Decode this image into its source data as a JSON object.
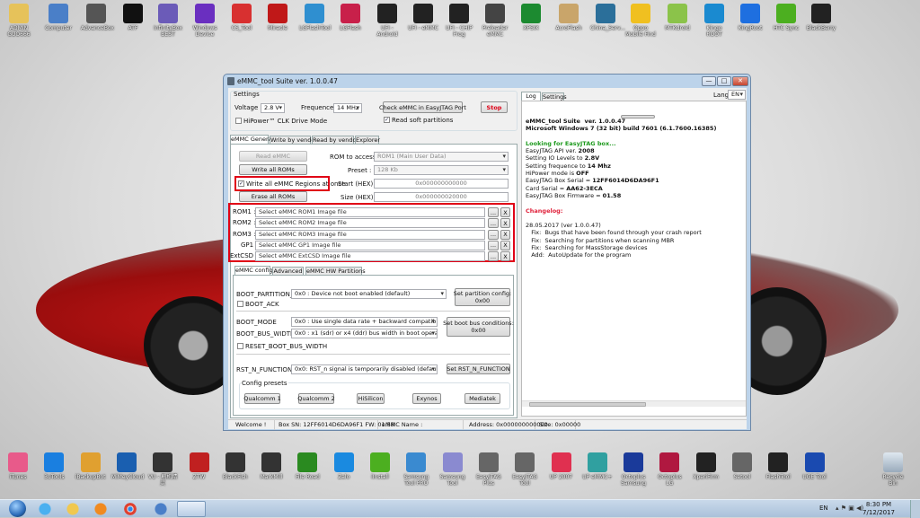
{
  "desktop": {
    "top_icons": [
      {
        "label": "ADMIN GUO666",
        "color": "#e6c25a"
      },
      {
        "label": "Computer",
        "color": "#4a7fc8"
      },
      {
        "label": "AdvanceBox",
        "color": "#555"
      },
      {
        "label": "ATF",
        "color": "#111"
      },
      {
        "label": "InfinityBox BEST",
        "color": "#6b5bb8"
      },
      {
        "label": "Windows Device",
        "color": "#6a2fc0"
      },
      {
        "label": "CS_Tool",
        "color": "#d83030"
      },
      {
        "label": "Miracle",
        "color": "#c01818"
      },
      {
        "label": "LGFlashTool",
        "color": "#2f8fd0"
      },
      {
        "label": "LGFlash",
        "color": "#c8204a"
      },
      {
        "label": "UFI - Android",
        "color": "#222"
      },
      {
        "label": "UFI - eMMC",
        "color": "#222"
      },
      {
        "label": "UFI - CHIP Prog",
        "color": "#222"
      },
      {
        "label": "Preloader eMMC",
        "color": "#444"
      },
      {
        "label": "XPSIX",
        "color": "#1c8a30"
      },
      {
        "label": "AcroFlash",
        "color": "#c9a56a"
      },
      {
        "label": "China_Serv...",
        "color": "#2b6f9a"
      },
      {
        "label": "Oppo Mobile Find",
        "color": "#f0c020"
      },
      {
        "label": "MTKdroid",
        "color": "#8bc34a"
      },
      {
        "label": "Kingo ROOT",
        "color": "#1a8ad0"
      },
      {
        "label": "KingRoot",
        "color": "#1e6fe0"
      },
      {
        "label": "HTC Sync",
        "color": "#4caf20"
      },
      {
        "label": "BlackBerry",
        "color": "#222"
      }
    ],
    "bottom_icons": [
      {
        "label": "iTunes",
        "color": "#e85a8a"
      },
      {
        "label": "3uTools",
        "color": "#1a7fe0"
      },
      {
        "label": "iBackupBot",
        "color": "#e0a030"
      },
      {
        "label": "MiMeyCloud",
        "color": "#1a5fb0"
      },
      {
        "label": "VU - 刷机精灵",
        "color": "#333"
      },
      {
        "label": "ZTW",
        "color": "#c02020"
      },
      {
        "label": "BlackFish",
        "color": "#333"
      },
      {
        "label": "MarkMill",
        "color": "#333"
      },
      {
        "label": "File Road",
        "color": "#2a8a20"
      },
      {
        "label": "Zalo",
        "color": "#1a8ae0"
      },
      {
        "label": "iInstall",
        "color": "#4caf20"
      },
      {
        "label": "Samsung Tool PRO",
        "color": "#3a8ad0"
      },
      {
        "label": "Samsung Tool",
        "color": "#8a8ad0"
      },
      {
        "label": "EasyJTAG Plus",
        "color": "#666"
      },
      {
        "label": "EasyJTAG Tool",
        "color": "#666"
      },
      {
        "label": "UP 2007",
        "color": "#e03050"
      },
      {
        "label": "UP eMMC+",
        "color": "#30a0a0"
      },
      {
        "label": "Octoplus Samsung",
        "color": "#1a3a9a"
      },
      {
        "label": "Octoplus LG",
        "color": "#b01840"
      },
      {
        "label": "XperiFirm",
        "color": "#222"
      },
      {
        "label": "Setool",
        "color": "#666"
      },
      {
        "label": "FlashTool",
        "color": "#222"
      },
      {
        "label": "UGE Tool",
        "color": "#1a4ab0"
      }
    ],
    "recycle_bin": "Recycle Bin"
  },
  "window": {
    "title": "eMMC_tool Suite  ver. 1.0.0.47",
    "controls": {
      "minimize": "—",
      "maximize": "□",
      "close": "✕"
    },
    "settings": {
      "group_label": "Settings",
      "voltage_label": "Voltage",
      "voltage_value": "2.8 V",
      "frequence_label": "Frequence",
      "frequence_value": "14 MHz",
      "check_button": "Check eMMC in EasyJTAG Port",
      "stop_button": "Stop",
      "hipower_label": "HiPower™ CLK Drive Mode",
      "hipower_checked": false,
      "read_soft_label": "Read soft partitions",
      "read_soft_checked": true
    },
    "main_tabs": [
      "eMMC General",
      "Write by vendor",
      "Read by vendor",
      "Explorer"
    ],
    "general": {
      "read_emmc": "Read eMMC",
      "write_all_roms": "Write all ROMs",
      "write_all_regions_label": "Write all eMMC Regions at once",
      "write_all_regions_checked": true,
      "erase_all_roms": "Erase all ROMs",
      "rom_access_label": "ROM to access :",
      "rom_access_value": "ROM1 (Main User Data)",
      "preset_label": "Preset :",
      "preset_value": "128 Kb",
      "start_label": "Start (HEX) :",
      "start_value": "0x000000000000",
      "size_label": "Size (HEX) :",
      "size_value": "0x000000020000",
      "files": [
        {
          "label": "ROM1 :",
          "placeholder": "Select eMMC ROM1 Image file"
        },
        {
          "label": "ROM2 :",
          "placeholder": "Select eMMC ROM2 Image file"
        },
        {
          "label": "ROM3 :",
          "placeholder": "Select eMMC ROM3 Image file"
        },
        {
          "label": "GP1 :",
          "placeholder": "Select eMMC GP1 Image file"
        },
        {
          "label": "ExtCSD :",
          "placeholder": "Select eMMC ExtCSD Image file"
        }
      ],
      "browse_label": "...",
      "clear_label": "X"
    },
    "config_tabs": [
      "eMMC config",
      "Advanced",
      "eMMC HW Partitions"
    ],
    "config": {
      "boot_partition_label": "BOOT_PARTITION_EN",
      "boot_partition_value": "0x0 : Device not boot enabled (default)",
      "boot_ack_label": "BOOT_ACK",
      "set_partition_button": [
        "Set partition config:",
        "0x00"
      ],
      "boot_mode_label": "BOOT_MODE",
      "boot_mode_value": "0x0 : Use single data rate + backward compatible timings in",
      "boot_bus_width_label": "BOOT_BUS_WIDTH",
      "boot_bus_width_value": "0x0 : x1 (sdr) or x4 (ddr) bus width in boot operation mode",
      "reset_boot_bus_label": "RESET_BOOT_BUS_WIDTH",
      "set_boot_bus_button": [
        "Set boot bus conditions:",
        "0x00"
      ],
      "rst_n_label": "RST_N_FUNCTION",
      "rst_n_value": "0x0: RST_n signal is temporarily disabled (default)",
      "set_rst_n_button": "Set RST_N_FUNCTION",
      "presets_label": "Config presets",
      "presets": [
        "Qualcomm 1",
        "Qualcomm 2",
        "HiSilicon",
        "Exynos",
        "Mediatek"
      ]
    },
    "right_tabs": [
      "Log",
      "Settings"
    ],
    "lang_label": "Lang",
    "lang_value": "EN",
    "log": {
      "lines": [
        {
          "text": "eMMC_tool Suite  ver. 1.0.0.47",
          "style": "b"
        },
        {
          "text": "Microsoft Windows 7 (32 bit) build 7601 (6.1.7600.16385)",
          "style": "b"
        },
        {
          "text": "",
          "style": ""
        },
        {
          "text": "Looking for EasyJTAG box...",
          "style": "green"
        },
        {
          "pre": "EasyJTAG API ver. ",
          "val": "2008"
        },
        {
          "pre": "Setting IO Levels to ",
          "val": "2.8V"
        },
        {
          "pre": "Setting frequence to ",
          "val": "14 Mhz"
        },
        {
          "pre": "HiPower mode is ",
          "val": "OFF"
        },
        {
          "pre": "EasyJTAG Box Serial = ",
          "val": "12FF6014D6DA96F1"
        },
        {
          "pre": "Card Serial = ",
          "val": "AA62-3ECA"
        },
        {
          "pre": "EasyJTAG Box Firmware = ",
          "val": "01.58"
        },
        {
          "text": "",
          "style": ""
        },
        {
          "text": "Changelog:",
          "style": "red"
        },
        {
          "text": "",
          "style": ""
        },
        {
          "text": "28.05.2017 (ver 1.0.0.47)",
          "style": ""
        },
        {
          "text": "   Fix:  Bugs that have been found through your crash report",
          "style": ""
        },
        {
          "text": "   Fix:  Searching for partitions when scanning MBR",
          "style": ""
        },
        {
          "text": "   Fix:  Searching for MassStorage devices",
          "style": ""
        },
        {
          "text": "   Add:  AutoUpdate for the program",
          "style": ""
        }
      ]
    },
    "status": {
      "welcome": "Welcome !",
      "box_sn": "Box SN: 12FF6014D6DA96F1  FW: 01.58",
      "emmc_name": "eMMC Name :",
      "address": "Address: 0x000000000000",
      "size": "Size: 0x00000"
    }
  },
  "taskbar": {
    "lang": "EN",
    "time": "8:30 PM",
    "date": "7/12/2017"
  },
  "colors": {
    "highlight_red": "#e00016",
    "log_green": "#1e9a1e",
    "log_red": "#e0203a",
    "stop_red": "#e00016"
  }
}
